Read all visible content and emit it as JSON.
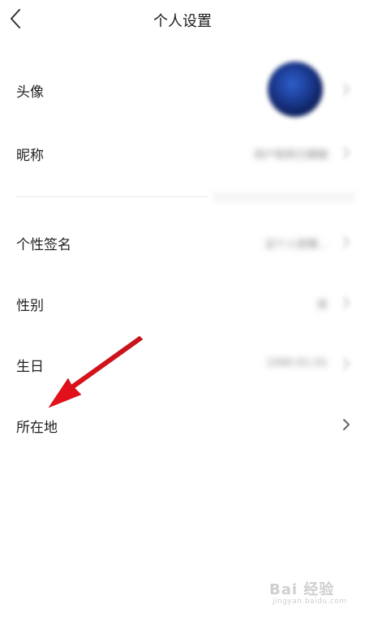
{
  "header": {
    "title": "个人设置",
    "back_icon": "chevron-left-icon"
  },
  "rows": [
    {
      "label": "头像",
      "value_type": "avatar"
    },
    {
      "label": "昵称",
      "value": "用户昵称已模糊"
    },
    {
      "label": "个性签名",
      "value": "这个人很懒..."
    },
    {
      "label": "性别",
      "value": "男"
    },
    {
      "label": "生日",
      "value": "1990-01-01"
    },
    {
      "label": "所在地",
      "value": ""
    }
  ],
  "watermark": {
    "text": "Bai 经验",
    "sub": "jingyan.baidu.com"
  },
  "colors": {
    "annotation_arrow": "#e8101a",
    "text": "#1f1f1f",
    "muted": "#888888",
    "divider": "#e7e7e7"
  }
}
